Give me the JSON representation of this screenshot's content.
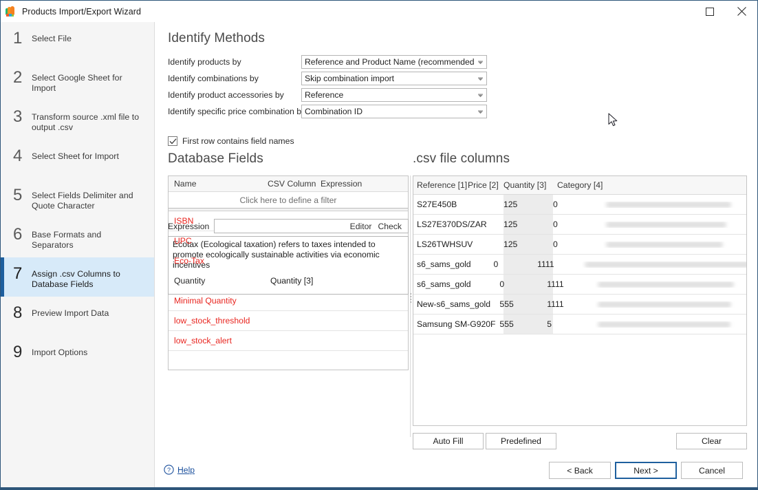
{
  "window": {
    "title": "Products Import/Export Wizard",
    "app_icon": "butterfly-icon",
    "maximize_label": "Maximize",
    "close_label": "Close"
  },
  "sidebar": {
    "steps": [
      {
        "num": "1",
        "label": "Select File",
        "state": "done"
      },
      {
        "num": "2",
        "label": "Select Google Sheet for Import",
        "state": "done"
      },
      {
        "num": "3",
        "label": "Transform source .xml file to output .csv",
        "state": "done"
      },
      {
        "num": "4",
        "label": "Select Sheet for Import",
        "state": "done"
      },
      {
        "num": "5",
        "label": "Select Fields Delimiter and Quote Character",
        "state": "done"
      },
      {
        "num": "6",
        "label": "Base Formats and Separators",
        "state": "done"
      },
      {
        "num": "7",
        "label": "Assign .csv Columns to Database Fields",
        "state": "active"
      },
      {
        "num": "8",
        "label": "Preview Import Data",
        "state": "future"
      },
      {
        "num": "9",
        "label": "Import Options",
        "state": "future"
      }
    ]
  },
  "identify": {
    "heading": "Identify Methods",
    "fields": [
      {
        "label": "Identify products by",
        "value": "Reference and Product Name (recommended)"
      },
      {
        "label": "Identify combinations by",
        "value": "Skip combination import"
      },
      {
        "label": "Identify product accessories by",
        "value": "Reference"
      },
      {
        "label": "Identify specific price combination by",
        "value": "Combination ID"
      }
    ],
    "first_row_checkbox": {
      "label": "First row contains field names",
      "checked": true
    }
  },
  "database_fields": {
    "heading": "Database Fields",
    "columns": [
      "Name",
      "CSV Column",
      "Expression"
    ],
    "filter_hint": "Click here to define a filter",
    "rows": [
      {
        "name": "ISBN",
        "csv_column": "",
        "expression": "",
        "unmapped": true,
        "selected": false
      },
      {
        "name": "UPC",
        "csv_column": "",
        "expression": "",
        "unmapped": true,
        "selected": false
      },
      {
        "name": "Eco-Tax",
        "csv_column": "",
        "expression": "",
        "unmapped": true,
        "selected": true
      },
      {
        "name": "Quantity",
        "csv_column": "Quantity [3]",
        "expression": "",
        "unmapped": false,
        "selected": false
      },
      {
        "name": "Minimal Quantity",
        "csv_column": "",
        "expression": "",
        "unmapped": true,
        "selected": false
      },
      {
        "name": "low_stock_threshold",
        "csv_column": "",
        "expression": "",
        "unmapped": true,
        "selected": false
      },
      {
        "name": "low_stock_alert",
        "csv_column": "",
        "expression": "",
        "unmapped": true,
        "selected": false
      }
    ]
  },
  "expression": {
    "label": "Expression",
    "value": "",
    "editor_link": "Editor",
    "check_link": "Check",
    "description": "Ecotax (Ecological taxation) refers to taxes intended to promote ecologically sustainable activities via economic incentives"
  },
  "csv_columns": {
    "heading": ".csv file columns",
    "columns": [
      "Reference [1]",
      "Price [2]",
      "Quantity [3]",
      "Category [4]"
    ],
    "rows": [
      {
        "reference": "S27E450B",
        "price": "125",
        "quantity": "0",
        "category": ""
      },
      {
        "reference": "LS27E370DS/ZAR",
        "price": "125",
        "quantity": "0",
        "category": ""
      },
      {
        "reference": "LS26TWHSUV",
        "price": "125",
        "quantity": "0",
        "category": ""
      },
      {
        "reference": "s6_sams_gold",
        "price": "0",
        "quantity": "1111",
        "category": ""
      },
      {
        "reference": "s6_sams_gold",
        "price": "0",
        "quantity": "1111",
        "category": ""
      },
      {
        "reference": "New-s6_sams_gold",
        "price": "555",
        "quantity": "1111",
        "category": ""
      },
      {
        "reference": "Samsung SM-G920F",
        "price": "555",
        "quantity": "5",
        "category": ""
      }
    ]
  },
  "actions": {
    "auto_fill": "Auto Fill",
    "predefined": "Predefined",
    "clear": "Clear"
  },
  "footer": {
    "help": "Help",
    "back": "< Back",
    "next": "Next >",
    "cancel": "Cancel"
  },
  "colors": {
    "accent": "#1e5f9e",
    "active_step_bg": "#d7eaf9",
    "unmapped_field": "#e8251f",
    "frame": "#2d5579"
  }
}
